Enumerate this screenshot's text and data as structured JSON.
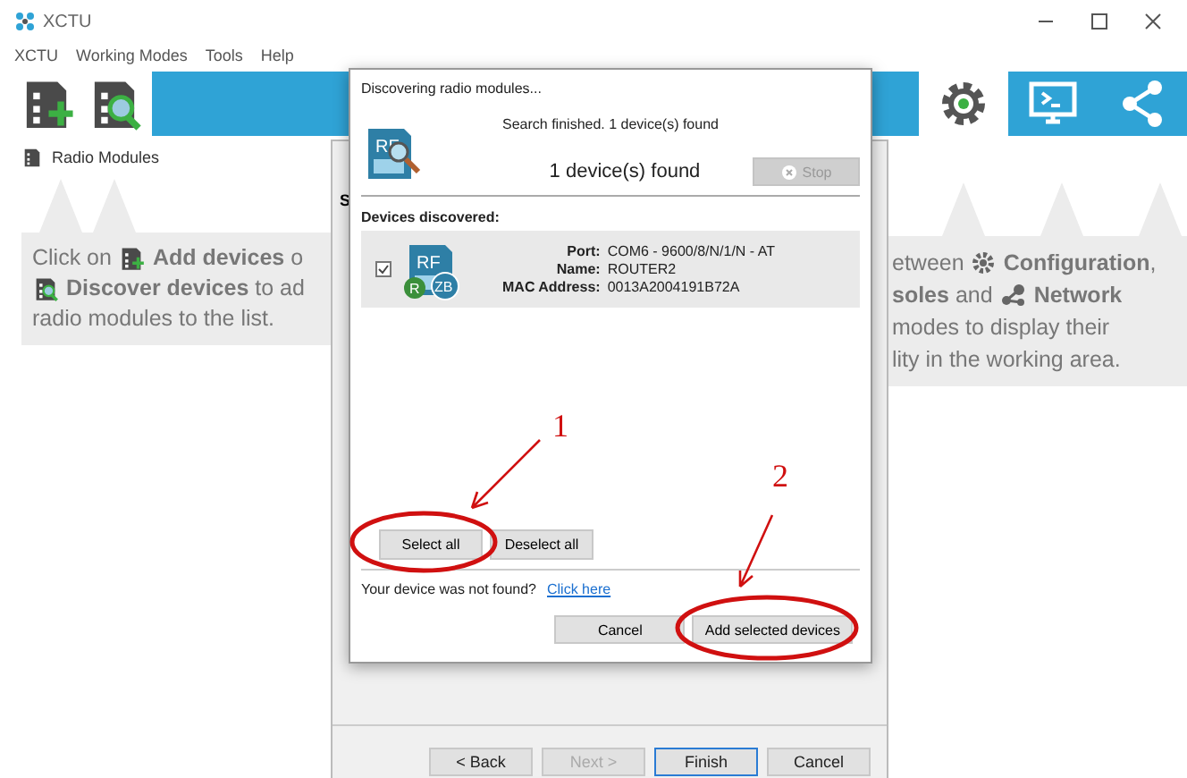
{
  "window": {
    "title": "XCTU"
  },
  "menu": [
    "XCTU",
    "Working Modes",
    "Tools",
    "Help"
  ],
  "toolbar": {
    "modes": [
      {
        "kind": "configuration",
        "selected": true
      },
      {
        "kind": "consoles",
        "selected": false
      },
      {
        "kind": "network",
        "selected": false
      }
    ]
  },
  "sidebar": {
    "title": "Radio Modules",
    "hint": [
      [
        {
          "kind": "text",
          "text": "Click on"
        },
        {
          "kind": "add_icon"
        },
        {
          "kind": "text",
          "text": "**Add devices** o"
        }
      ],
      [
        {
          "kind": "discover_icon"
        },
        {
          "kind": "text",
          "text": "**Discover devices** to ad"
        }
      ],
      [
        {
          "kind": "text",
          "text": "radio modules to the list."
        }
      ]
    ]
  },
  "workspace_hint": [
    [
      {
        "kind": "text",
        "text": "etween"
      },
      {
        "kind": "gear_icon"
      },
      {
        "kind": "text",
        "text": "**Configuration**,"
      }
    ],
    [
      {
        "kind": "text",
        "text": "**soles** and"
      },
      {
        "kind": "network_icon"
      },
      {
        "kind": "text",
        "text": "**Network**"
      }
    ],
    [
      {
        "kind": "text",
        "text": "modes to display their"
      }
    ],
    [
      {
        "kind": "text",
        "text": "lity in the working area."
      }
    ]
  ],
  "wizard": {
    "heading": "S",
    "buttons": [
      {
        "label": "< Back",
        "disabled": false,
        "default": false
      },
      {
        "label": "Next >",
        "disabled": true,
        "default": false
      },
      {
        "label": "Finish",
        "disabled": false,
        "default": true
      },
      {
        "label": "Cancel",
        "disabled": false,
        "default": false
      }
    ]
  },
  "dialog": {
    "title": "Discovering radio modules...",
    "status": "Search finished. 1 device(s) found",
    "icon_mark": "RF",
    "count": "1 device(s) found",
    "stop": {
      "label": "Stop",
      "disabled": true
    },
    "section": "Devices discovered:",
    "devices": [
      {
        "checked": true,
        "mark": "RF",
        "role": "R",
        "protocol": "ZB",
        "fields": [
          {
            "label": "Port:",
            "value": "COM6 - 9600/8/N/1/N - AT"
          },
          {
            "label": "Name:",
            "value": "ROUTER2"
          },
          {
            "label": "MAC Address:",
            "value": "0013A2004191B72A"
          }
        ]
      }
    ],
    "selection_buttons": [
      "Select all",
      "Deselect all"
    ],
    "not_found": {
      "text": "Your device was not found?",
      "link": "Click here"
    },
    "buttons": [
      "Cancel",
      "Add selected devices"
    ]
  },
  "annotations": [
    {
      "label": "1"
    },
    {
      "label": "2"
    }
  ]
}
